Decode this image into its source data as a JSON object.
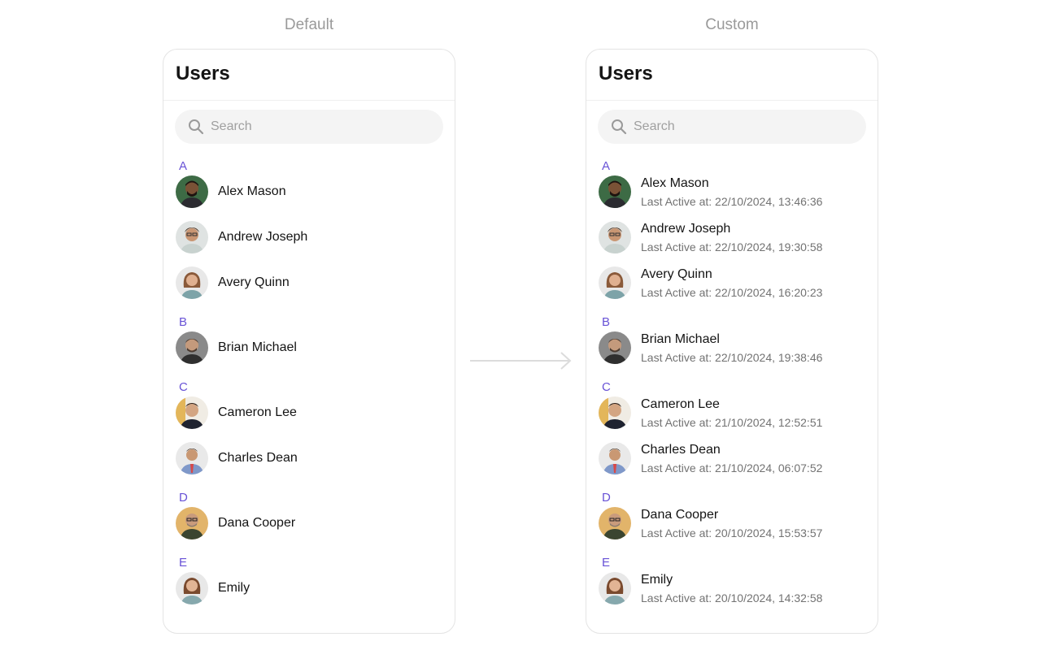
{
  "labels": {
    "default": "Default",
    "custom": "Custom"
  },
  "default_panel": {
    "title": "Users",
    "search_placeholder": "Search",
    "sections": [
      {
        "letter": "A",
        "users": [
          {
            "name": "Alex Mason"
          },
          {
            "name": "Andrew Joseph"
          },
          {
            "name": "Avery Quinn"
          }
        ]
      },
      {
        "letter": "B",
        "users": [
          {
            "name": "Brian Michael"
          }
        ]
      },
      {
        "letter": "C",
        "users": [
          {
            "name": "Cameron Lee"
          },
          {
            "name": "Charles Dean"
          }
        ]
      },
      {
        "letter": "D",
        "users": [
          {
            "name": "Dana Cooper"
          }
        ]
      },
      {
        "letter": "E",
        "users": [
          {
            "name": "Emily"
          }
        ]
      }
    ]
  },
  "custom_panel": {
    "title": "Users",
    "search_placeholder": "Search",
    "sections": [
      {
        "letter": "A",
        "users": [
          {
            "name": "Alex Mason",
            "last_active": "Last Active at: 22/10/2024, 13:46:36"
          },
          {
            "name": "Andrew Joseph",
            "last_active": "Last Active at: 22/10/2024, 19:30:58"
          },
          {
            "name": "Avery Quinn",
            "last_active": "Last Active at: 22/10/2024, 16:20:23"
          }
        ]
      },
      {
        "letter": "B",
        "users": [
          {
            "name": "Brian Michael",
            "last_active": "Last Active at: 22/10/2024, 19:38:46"
          }
        ]
      },
      {
        "letter": "C",
        "users": [
          {
            "name": "Cameron Lee",
            "last_active": "Last Active at: 21/10/2024, 12:52:51"
          },
          {
            "name": "Charles Dean",
            "last_active": "Last Active at: 21/10/2024, 06:07:52"
          }
        ]
      },
      {
        "letter": "D",
        "users": [
          {
            "name": "Dana Cooper",
            "last_active": "Last Active at: 20/10/2024, 15:53:57"
          }
        ]
      },
      {
        "letter": "E",
        "users": [
          {
            "name": "Emily",
            "last_active": "Last Active at: 20/10/2024, 14:32:58"
          }
        ]
      }
    ]
  },
  "colors": {
    "section_letter": "#6852d6",
    "search_bg": "#f4f4f4",
    "border": "#e4e4e4"
  }
}
